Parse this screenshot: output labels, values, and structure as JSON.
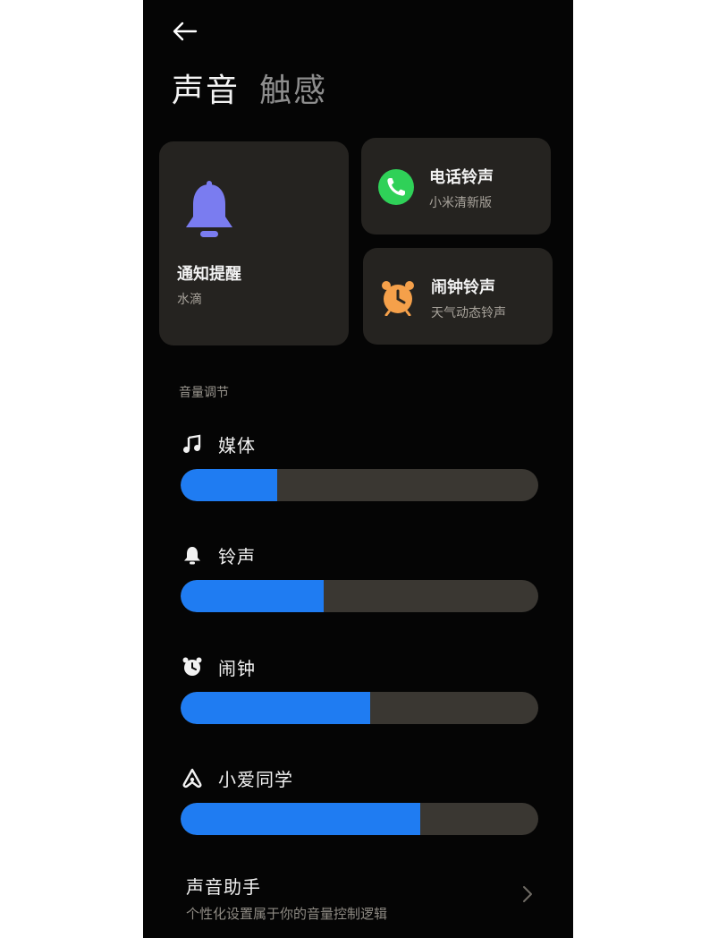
{
  "header": {
    "tabs": [
      {
        "label": "声音",
        "active": true
      },
      {
        "label": "触感",
        "active": false
      }
    ]
  },
  "cards": {
    "notification": {
      "title": "通知提醒",
      "subtitle": "水滴",
      "icon": "bell-icon",
      "icon_color": "#7a7cf0"
    },
    "phone_ringtone": {
      "title": "电话铃声",
      "subtitle": "小米清新版",
      "icon": "phone-icon",
      "icon_color": "#2fd158"
    },
    "alarm_ringtone": {
      "title": "闹钟铃声",
      "subtitle": "天气动态铃声",
      "icon": "alarm-clock-icon",
      "icon_color": "#f5a04a"
    }
  },
  "volume": {
    "section_label": "音量调节",
    "items": [
      {
        "label": "媒体",
        "icon": "music-note-icon",
        "level": 0.27
      },
      {
        "label": "铃声",
        "icon": "bell-icon",
        "level": 0.4
      },
      {
        "label": "闹钟",
        "icon": "alarm-clock-icon",
        "level": 0.53
      },
      {
        "label": "小爱同学",
        "icon": "xiaoai-assistant-icon",
        "level": 0.67
      }
    ],
    "fill_color": "#1f7cf2",
    "track_color": "#3a3732"
  },
  "assistant": {
    "title": "声音助手",
    "subtitle": "个性化设置属于你的音量控制逻辑"
  },
  "colors": {
    "background": "#050505",
    "card": "#252320"
  }
}
